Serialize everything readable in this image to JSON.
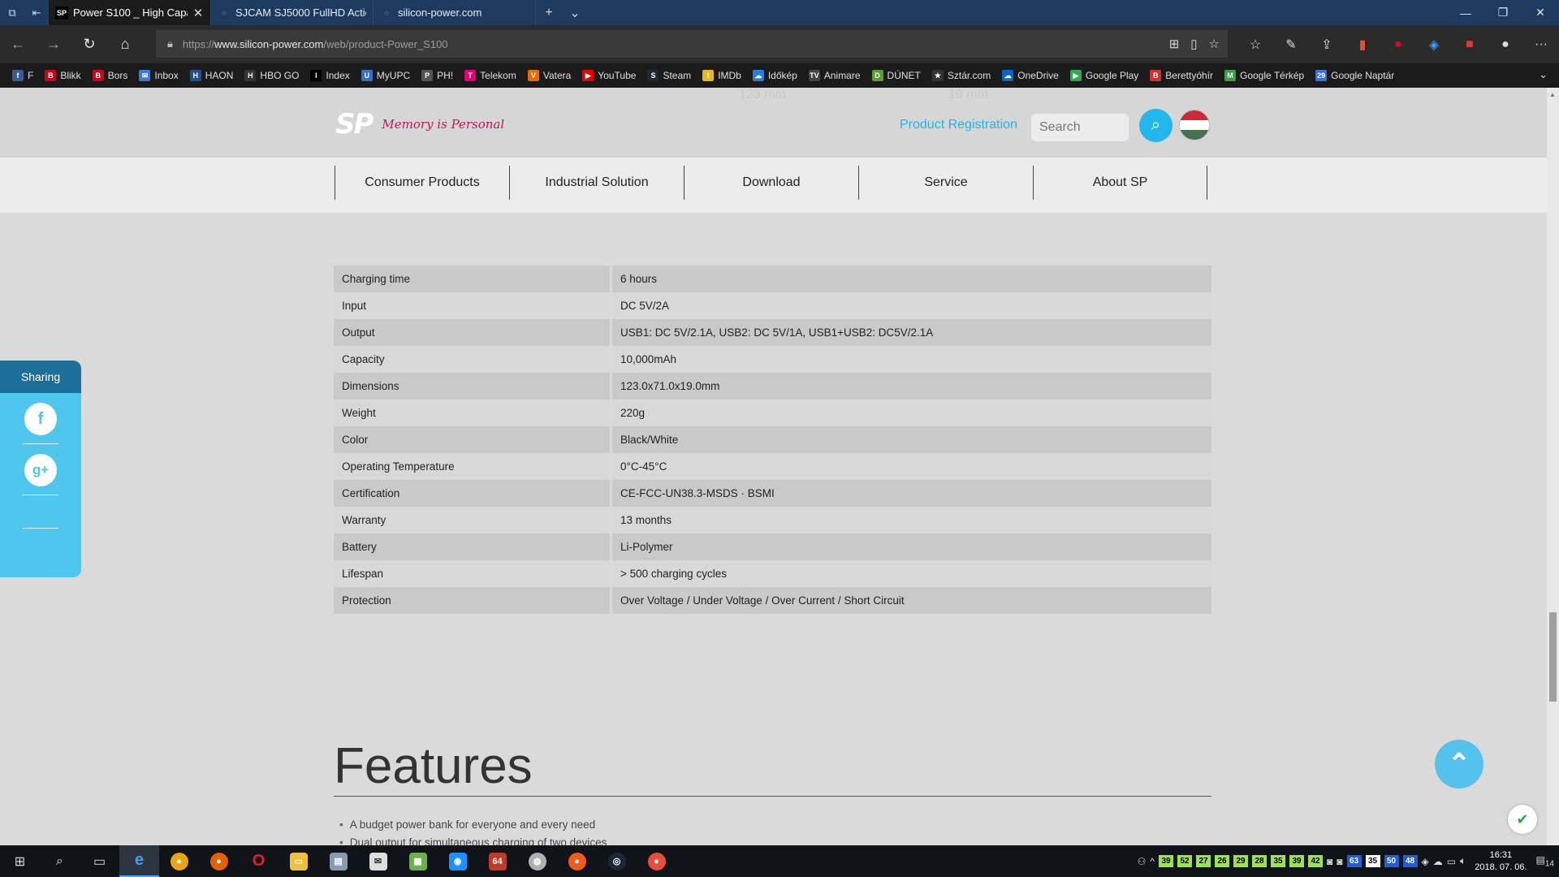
{
  "browser": {
    "tabs": [
      {
        "title": "Power S100 _ High Capa",
        "active": true
      },
      {
        "title": "SJCAM SJ5000 FullHD Actio",
        "active": false
      },
      {
        "title": "silicon-power.com",
        "active": false
      }
    ],
    "url_prefix": "https://",
    "url_domain": "www.silicon-power.com",
    "url_path": "/web/product-Power_S100"
  },
  "favorites": [
    {
      "label": "F",
      "icon": "f",
      "color": "#3b5998"
    },
    {
      "label": "Blikk",
      "icon": "B",
      "color": "#d0021b"
    },
    {
      "label": "Bors",
      "icon": "B",
      "color": "#d0021b"
    },
    {
      "label": "Inbox",
      "icon": "✉",
      "color": "#3d7bd6"
    },
    {
      "label": "HAON",
      "icon": "H",
      "color": "#1f4f8c"
    },
    {
      "label": "HBO GO",
      "icon": "H",
      "color": "#333"
    },
    {
      "label": "Index",
      "icon": "I",
      "color": "#000"
    },
    {
      "label": "MyUPC",
      "icon": "U",
      "color": "#3a6fc4"
    },
    {
      "label": "PH!",
      "icon": "P",
      "color": "#555"
    },
    {
      "label": "Telekom",
      "icon": "T",
      "color": "#e20074"
    },
    {
      "label": "Vatera",
      "icon": "V",
      "color": "#e86a00"
    },
    {
      "label": "YouTube",
      "icon": "▶",
      "color": "#e00"
    },
    {
      "label": "Steam",
      "icon": "S",
      "color": "#1b2838"
    },
    {
      "label": "IMDb",
      "icon": "I",
      "color": "#e6b91e"
    },
    {
      "label": "Időkép",
      "icon": "☁",
      "color": "#2a7fd4"
    },
    {
      "label": "Animare",
      "icon": "TV",
      "color": "#444"
    },
    {
      "label": "DÚNET",
      "icon": "D",
      "color": "#5aa02c"
    },
    {
      "label": "Sztár.com",
      "icon": "★",
      "color": "#333"
    },
    {
      "label": "OneDrive",
      "icon": "☁",
      "color": "#0a64c8"
    },
    {
      "label": "Google Play",
      "icon": "▶",
      "color": "#2fa84f"
    },
    {
      "label": "Berettyóhír",
      "icon": "B",
      "color": "#c33"
    },
    {
      "label": "Google Térkép",
      "icon": "M",
      "color": "#3c9c4a"
    },
    {
      "label": "Google Naptár",
      "icon": "29",
      "color": "#3a70d8"
    }
  ],
  "header": {
    "logo": "SP",
    "tagline": "Memory is Personal",
    "product_registration": "Product Registration",
    "search_placeholder": "Search",
    "ghost_left": "123 mm",
    "ghost_right": "19 mm"
  },
  "nav": [
    "Consumer Products",
    "Industrial Solution",
    "Download",
    "Service",
    "About SP"
  ],
  "specs": [
    {
      "k": "Charging time",
      "v": "6 hours"
    },
    {
      "k": "Input",
      "v": "DC 5V/2A"
    },
    {
      "k": "Output",
      "v": "USB1: DC 5V/2.1A, USB2: DC 5V/1A, USB1+USB2: DC5V/2.1A"
    },
    {
      "k": "Capacity",
      "v": "10,000mAh"
    },
    {
      "k": "Dimensions",
      "v": "123.0x71.0x19.0mm"
    },
    {
      "k": "Weight",
      "v": "220g"
    },
    {
      "k": "Color",
      "v": "Black/White"
    },
    {
      "k": "Operating Temperature",
      "v": "0°C-45°C"
    },
    {
      "k": "Certification",
      "v": "CE-FCC-UN38.3-MSDS · BSMI"
    },
    {
      "k": "Warranty",
      "v": "13 months"
    },
    {
      "k": "Battery",
      "v": "Li-Polymer"
    },
    {
      "k": "Lifespan",
      "v": "> 500 charging cycles"
    },
    {
      "k": "Protection",
      "v": "Over Voltage / Under Voltage / Over Current / Short Circuit"
    }
  ],
  "features": {
    "title": "Features",
    "items": [
      "A budget power bank for everyone and every need",
      "Dual output for simultaneous charging of two devices"
    ]
  },
  "sharing": {
    "title": "Sharing"
  },
  "taskbar": {
    "tray_numbers": [
      "39",
      "52",
      "27",
      "26",
      "29",
      "28",
      "35",
      "39",
      "42"
    ],
    "extra_numbers": [
      "63",
      "35",
      "50",
      "48"
    ],
    "time": "16:31",
    "date": "2018. 07. 06.",
    "notifications": "14"
  },
  "colors": {
    "accent": "#21b7ea",
    "sharing": "#4fc6ee",
    "sharing_head": "#1d6f9a"
  }
}
